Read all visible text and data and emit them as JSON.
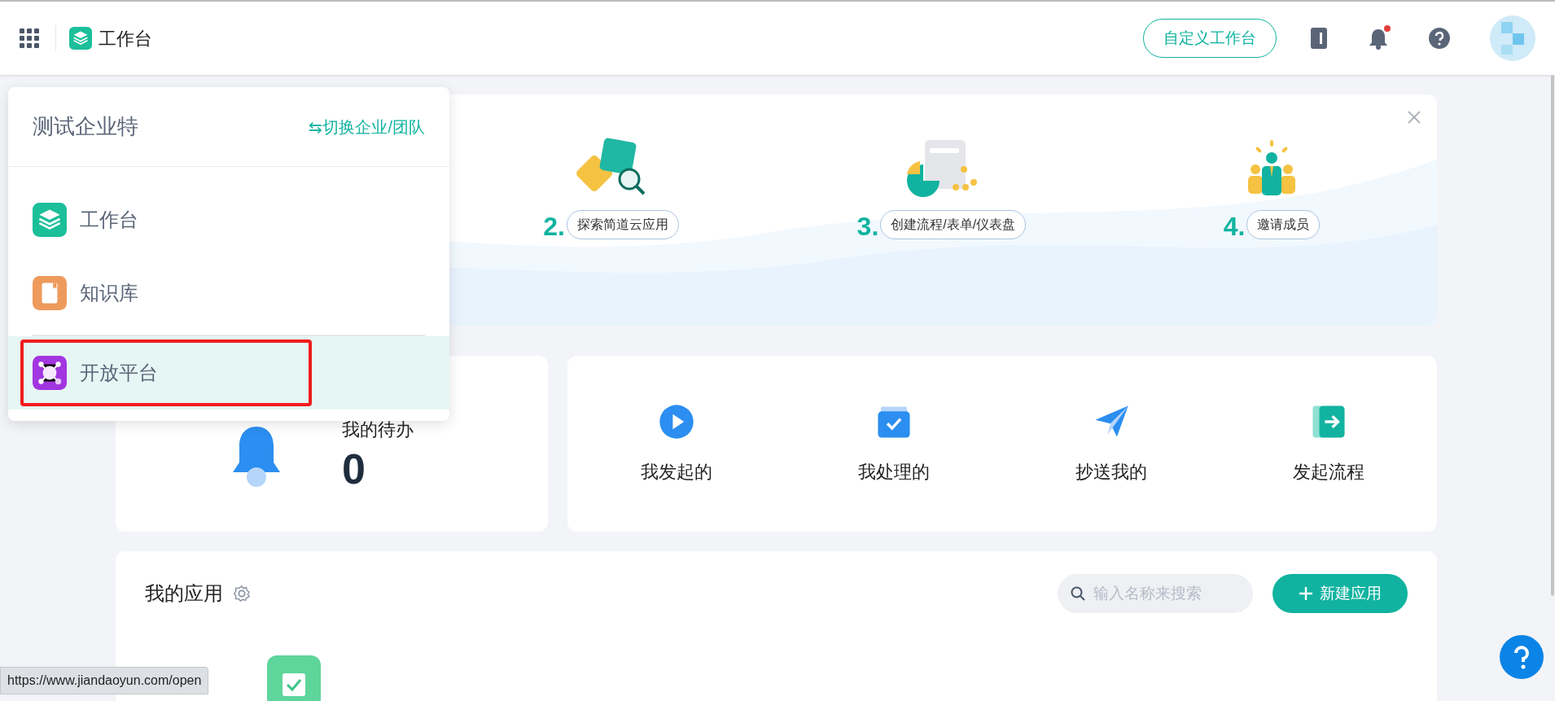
{
  "topbar": {
    "title": "工作台",
    "customize_button": "自定义工作台",
    "notification_dot": true
  },
  "org_menu": {
    "org_name": "测试企业特",
    "switch_link": "⇆切换企业/团队",
    "items": [
      {
        "label": "工作台",
        "kind": "workbench",
        "selected": false
      },
      {
        "label": "知识库",
        "kind": "knowledge",
        "selected": false
      },
      {
        "label": "开放平台",
        "kind": "open",
        "selected": true
      }
    ]
  },
  "guide": {
    "steps": [
      {
        "number": "2.",
        "label": "探索简道云应用",
        "kind": "explore"
      },
      {
        "number": "3.",
        "label": "创建流程/表单/仪表盘",
        "kind": "create"
      },
      {
        "number": "4.",
        "label": "邀请成员",
        "kind": "invite"
      }
    ]
  },
  "todo": {
    "title": "我的待办",
    "count": "0"
  },
  "flows": [
    {
      "label": "我发起的",
      "kind": "started"
    },
    {
      "label": "我处理的",
      "kind": "handled"
    },
    {
      "label": "抄送我的",
      "kind": "cc"
    },
    {
      "label": "发起流程",
      "kind": "launch"
    }
  ],
  "my_apps": {
    "title": "我的应用",
    "search": {
      "placeholder": "输入名称来搜索"
    },
    "new_button": "新建应用"
  },
  "status_url": "https://www.jiandaoyun.com/open"
}
